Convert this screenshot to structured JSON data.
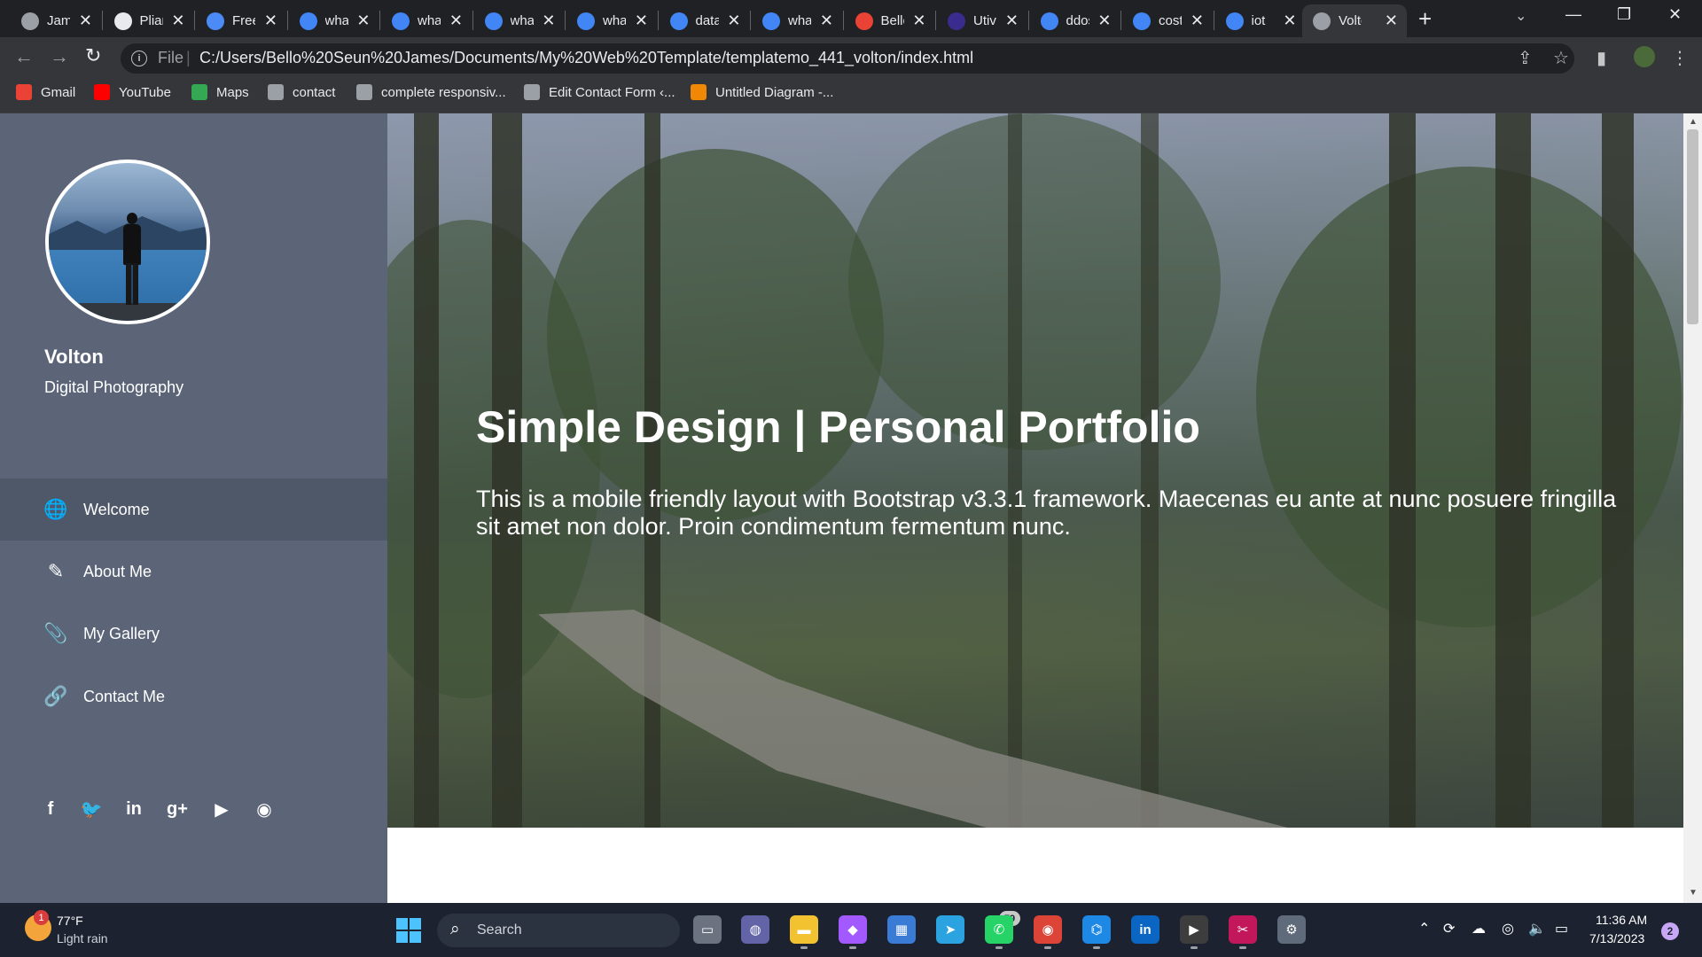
{
  "browser": {
    "tabs": [
      {
        "title": "James Bello",
        "favicon": "chrome-icon",
        "color": "#9aa0a6"
      },
      {
        "title": "Pliant",
        "favicon": "pliant-icon",
        "color": "#e8eaed"
      },
      {
        "title": "Free",
        "favicon": "free-icon",
        "color": "#4c8bf5"
      },
      {
        "title": "what",
        "favicon": "google-icon",
        "color": "#4285f4"
      },
      {
        "title": "what",
        "favicon": "google-icon",
        "color": "#4285f4"
      },
      {
        "title": "what",
        "favicon": "google-icon",
        "color": "#4285f4"
      },
      {
        "title": "what",
        "favicon": "google-icon",
        "color": "#4285f4"
      },
      {
        "title": "data",
        "favicon": "google-icon",
        "color": "#4285f4"
      },
      {
        "title": "what",
        "favicon": "google-icon",
        "color": "#4285f4"
      },
      {
        "title": "Bello",
        "favicon": "gmail-icon",
        "color": "#ea4335"
      },
      {
        "title": "Utiva",
        "favicon": "utiva-icon",
        "color": "#3a2b8f"
      },
      {
        "title": "ddos",
        "favicon": "google-icon",
        "color": "#4285f4"
      },
      {
        "title": "cost",
        "favicon": "google-icon",
        "color": "#4285f4"
      },
      {
        "title": "iot",
        "favicon": "google-icon",
        "color": "#4285f4"
      },
      {
        "title": "Volton",
        "favicon": "globe-icon",
        "color": "#9aa0a6",
        "active": true
      }
    ],
    "tab_close_glyph": "✕",
    "new_tab_glyph": "+",
    "url_scheme": "File",
    "url": "C:/Users/Bello%20Seun%20James/Documents/My%20Web%20Template/templatemo_441_volton/index.html",
    "bookmarks": [
      {
        "label": "Gmail",
        "icon": "gmail-icon",
        "color": "#ea4335"
      },
      {
        "label": "YouTube",
        "icon": "youtube-icon",
        "color": "#ff0000"
      },
      {
        "label": "Maps",
        "icon": "maps-icon",
        "color": "#34a853"
      },
      {
        "label": "contact",
        "icon": "globe-icon",
        "color": "#9aa0a6"
      },
      {
        "label": "complete responsiv...",
        "icon": "globe-icon",
        "color": "#9aa0a6"
      },
      {
        "label": "Edit Contact Form ‹...",
        "icon": "loading-icon",
        "color": "#9aa0a6"
      },
      {
        "label": "Untitled Diagram -...",
        "icon": "drawio-icon",
        "color": "#f08705"
      }
    ]
  },
  "sidebar": {
    "site_name": "Volton",
    "tagline": "Digital Photography",
    "nav": [
      {
        "label": "Welcome",
        "icon": "globe-icon",
        "glyph": "🌐",
        "active": true
      },
      {
        "label": "About Me",
        "icon": "pencil-icon",
        "glyph": "✎",
        "active": false
      },
      {
        "label": "My Gallery",
        "icon": "paperclip-icon",
        "glyph": "📎",
        "active": false
      },
      {
        "label": "Contact Me",
        "icon": "link-icon",
        "glyph": "🔗",
        "active": false
      }
    ],
    "social": [
      {
        "name": "facebook-icon",
        "glyph": "f"
      },
      {
        "name": "twitter-icon",
        "glyph": "🐦"
      },
      {
        "name": "linkedin-icon",
        "glyph": "in"
      },
      {
        "name": "google-plus-icon",
        "glyph": "g+"
      },
      {
        "name": "youtube-icon",
        "glyph": "▶"
      },
      {
        "name": "rss-icon",
        "glyph": "◉"
      }
    ]
  },
  "hero": {
    "title": "Simple Design | Personal Portfolio",
    "text": "This is a mobile friendly layout with Bootstrap v3.3.1 framework. Maecenas eu ante at nunc posuere fringilla sit amet non dolor. Proin condimentum fermentum nunc."
  },
  "taskbar": {
    "weather_badge": "1",
    "weather_temp": "77°F",
    "weather_desc": "Light rain",
    "search_label": "Search",
    "apps": [
      {
        "name": "task-view-icon",
        "glyph": "▭",
        "color": "#6b7280"
      },
      {
        "name": "teams-chat-icon",
        "glyph": "◍",
        "color": "#6264a7"
      },
      {
        "name": "file-explorer-icon",
        "glyph": "▬",
        "color": "#f2c230"
      },
      {
        "name": "figma-icon",
        "glyph": "◆",
        "color": "#a259ff"
      },
      {
        "name": "microsoft-store-icon",
        "glyph": "▦",
        "color": "#3a7bd5"
      },
      {
        "name": "telegram-icon",
        "glyph": "➤",
        "color": "#2aa3e0"
      },
      {
        "name": "whatsapp-icon",
        "glyph": "✆",
        "color": "#25d366"
      },
      {
        "name": "chrome-icon",
        "glyph": "◉",
        "color": "#db4437"
      },
      {
        "name": "vscode-icon",
        "glyph": "⌬",
        "color": "#1e88e5"
      },
      {
        "name": "linkedin-icon",
        "glyph": "in",
        "color": "#0a66c2"
      },
      {
        "name": "media-player-icon",
        "glyph": "▶",
        "color": "#3d3d3d"
      },
      {
        "name": "snipping-tool-icon",
        "glyph": "✂",
        "color": "#c2185b"
      },
      {
        "name": "settings-icon",
        "glyph": "⚙",
        "color": "#5f6b7a"
      }
    ],
    "whatsapp_badge": "79",
    "time": "11:36 AM",
    "date": "7/13/2023",
    "notification_count": "2"
  }
}
